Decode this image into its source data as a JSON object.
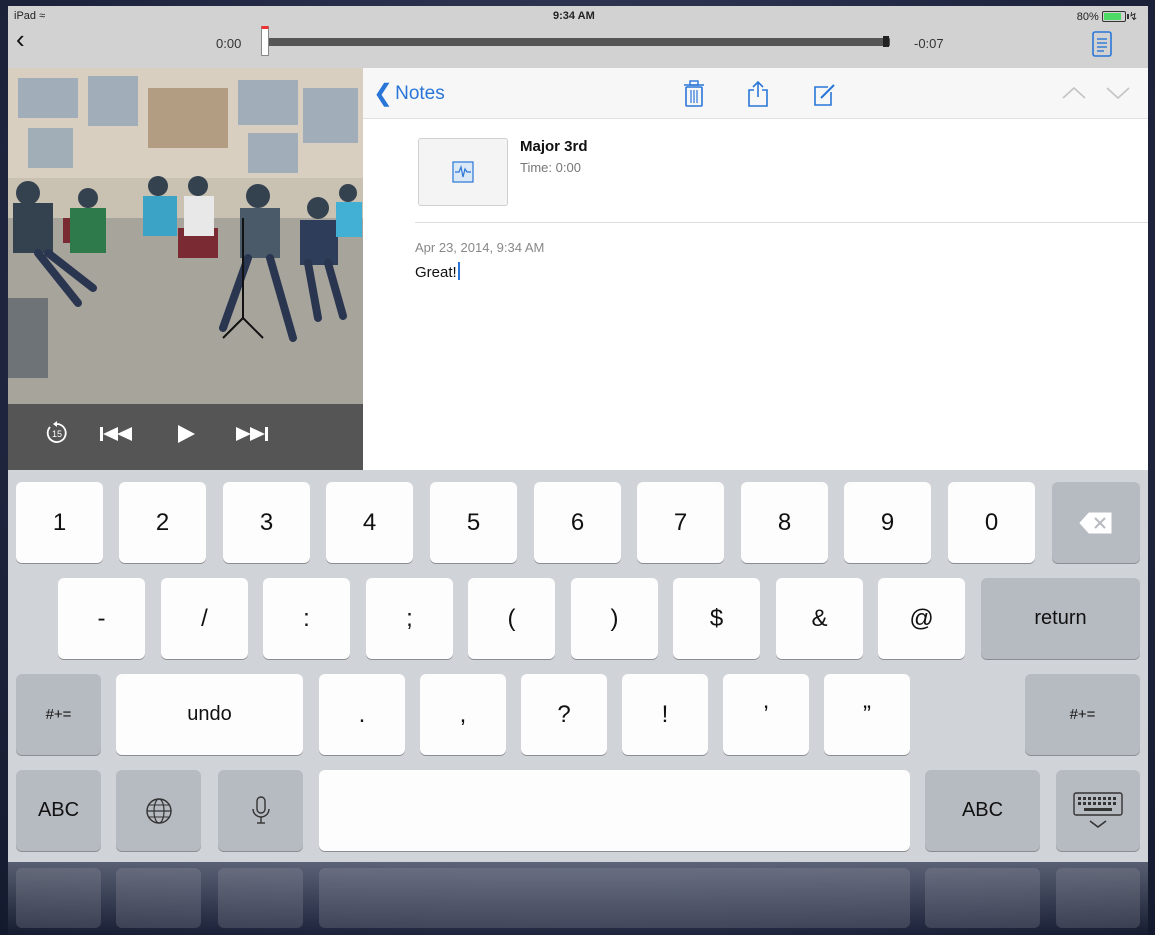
{
  "status": {
    "device": "iPad",
    "time": "9:34 AM",
    "battery": "80%"
  },
  "scrubber": {
    "elapsed": "0:00",
    "remaining": "-0:07",
    "progress": 0.0
  },
  "notes_nav": {
    "back_label": "Notes"
  },
  "note": {
    "clip_title": "Major 3rd",
    "clip_time": "Time: 0:00",
    "date": "Apr 23, 2014, 9:34 AM",
    "text": "Great!"
  },
  "transport": {
    "skip_back_seconds": "15"
  },
  "keyboard": {
    "row1": [
      "1",
      "2",
      "3",
      "4",
      "5",
      "6",
      "7",
      "8",
      "9",
      "0"
    ],
    "row2": [
      "-",
      "/",
      ":",
      ";",
      "(",
      ")",
      "$",
      "&",
      "@"
    ],
    "return_label": "return",
    "row3_symbols_label": "#+=",
    "undo_label": "undo",
    "row3": [
      ".",
      ",",
      "?",
      "!",
      "’",
      "”"
    ],
    "abc_label": "ABC"
  },
  "colors": {
    "accent": "#2a76d8",
    "battery": "#4cd964"
  }
}
